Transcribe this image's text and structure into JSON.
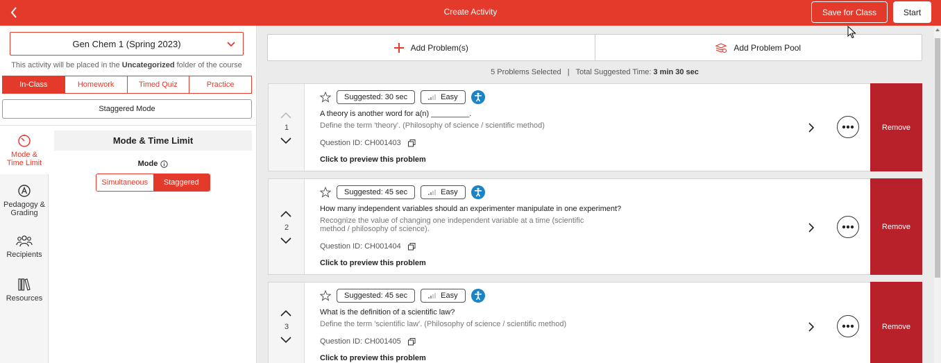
{
  "topbar": {
    "title": "Create Activity",
    "save_label": "Save for Class",
    "start_label": "Start"
  },
  "left": {
    "course": "Gen Chem 1 (Spring 2023)",
    "note_prefix": "This activity will be placed in the ",
    "note_folder": "Uncategorized",
    "note_suffix": " folder of the course",
    "tabs": [
      "In-Class",
      "Homework",
      "Timed Quiz",
      "Practice"
    ],
    "active_tab": "In-Class",
    "staggered_mode_label": "Staggered Mode",
    "sidenav": [
      {
        "label1": "Mode &",
        "label2": "Time Limit",
        "icon": "timer-icon"
      },
      {
        "label1": "Pedagogy &",
        "label2": "Grading",
        "icon": "pedagogy-icon"
      },
      {
        "label1": "Recipients",
        "label2": "",
        "icon": "people-icon"
      },
      {
        "label1": "Resources",
        "label2": "",
        "icon": "books-icon"
      }
    ],
    "panel_title": "Mode & Time Limit",
    "mode_label": "Mode",
    "mode_options": [
      "Simultaneous",
      "Staggered"
    ],
    "mode_selected": "Staggered"
  },
  "right": {
    "add_problems": "Add Problem(s)",
    "add_pool": "Add Problem Pool",
    "summary_count": "5 Problems Selected",
    "summary_sep": "|",
    "summary_time_label": "Total Suggested Time: ",
    "summary_time": "3 min 30 sec",
    "remove_label": "Remove",
    "preview_label": "Click to preview this problem",
    "difficulty_label": "Easy",
    "problems": [
      {
        "num": "1",
        "suggested": "Suggested:  30 sec",
        "question": "A theory is another word for a(n) _________.",
        "desc": "Define the term 'theory'. (Philosophy of science / scientific method)",
        "qid": "Question ID: CH001403"
      },
      {
        "num": "2",
        "suggested": "Suggested:  45 sec",
        "question": "How many independent variables should an experimenter manipulate in one experiment?",
        "desc": "Recognize the value of changing one independent variable at a time (scientific method / philosophy of science).",
        "qid": "Question ID: CH001404"
      },
      {
        "num": "3",
        "suggested": "Suggested:  45 sec",
        "question": "What is the definition of a scientific law?",
        "desc": "Define the term 'scientific law'. (Philosophy of science / scientific method)",
        "qid": "Question ID: CH001405"
      }
    ]
  },
  "colors": {
    "brand_red": "#e43a2b",
    "remove_red": "#b8202a",
    "accessibility_blue": "#1a84c7"
  }
}
